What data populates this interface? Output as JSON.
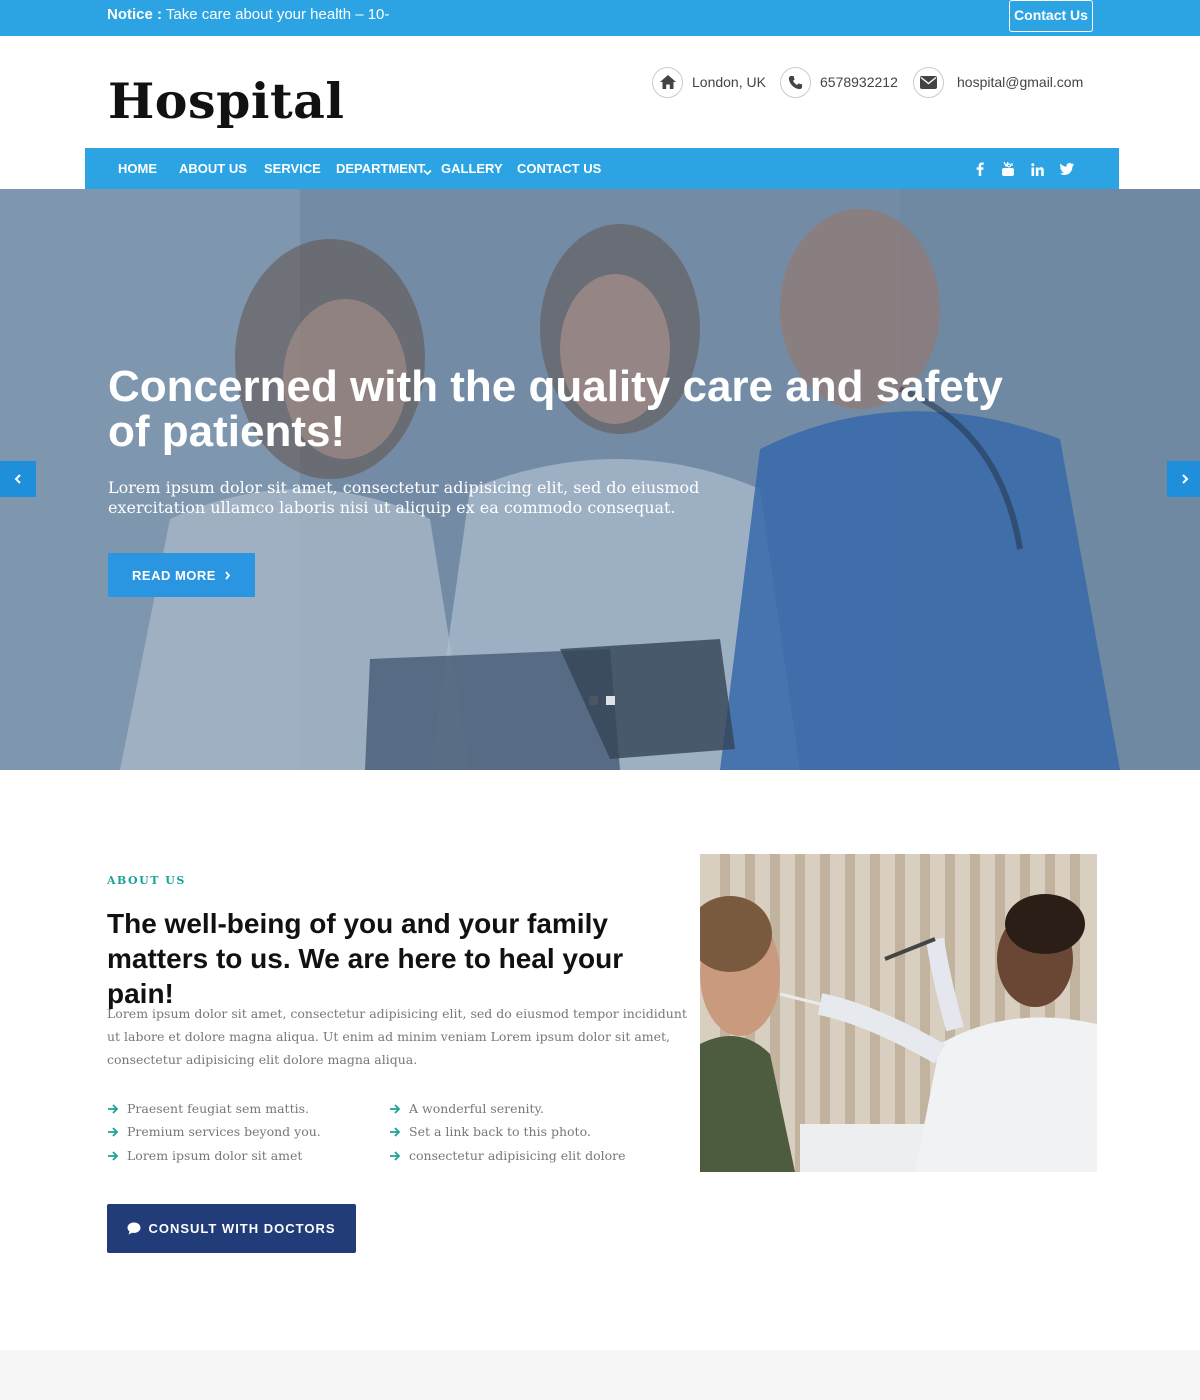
{
  "topbar": {
    "notice_label": "Notice :",
    "notice_text": "Take care about your health – 10-",
    "contact_button": "Contact Us"
  },
  "header": {
    "logo": "Hospital",
    "contacts": [
      {
        "icon": "home-icon",
        "text": "London, UK"
      },
      {
        "icon": "phone-icon",
        "text": "6578932212"
      },
      {
        "icon": "envelope-icon",
        "text": "hospital@gmail.com"
      }
    ]
  },
  "nav": {
    "items": [
      "HOME",
      "ABOUT US",
      "SERVICE",
      "DEPARTMENT",
      "GALLERY",
      "CONTACT US"
    ],
    "social": [
      "facebook-icon",
      "youtube-icon",
      "linkedin-icon",
      "twitter-icon"
    ]
  },
  "hero": {
    "title": "Concerned with the quality care and safety of patients!",
    "text": "Lorem ipsum dolor sit amet, consectetur adipisicing elit, sed do eiusmod exercitation ullamco laboris nisi ut aliquip ex ea commodo consequat.",
    "button": "READ MORE",
    "slides": 2,
    "active_slide": 1
  },
  "about": {
    "label": "ABOUT US",
    "title": "The well-being of you and your family matters to us. We are here to heal your pain!",
    "text": "Lorem ipsum dolor sit amet, consectetur adipisicing elit, sed do eiusmod tempor incididunt ut labore et dolore magna aliqua. Ut enim ad minim veniam Lorem ipsum dolor sit amet, consectetur adipisicing elit dolore magna aliqua.",
    "features_left": [
      "Praesent feugiat sem mattis.",
      "Premium services beyond you.",
      "Lorem ipsum dolor sit amet"
    ],
    "features_right": [
      "A wonderful serenity.",
      "Set a link back to this photo.",
      "consectetur adipisicing elit dolore"
    ],
    "button": "CONSULT WITH DOCTORS"
  },
  "colors": {
    "primary": "#2ca4e4",
    "navy": "#223c7a",
    "teal": "#1aa399"
  }
}
